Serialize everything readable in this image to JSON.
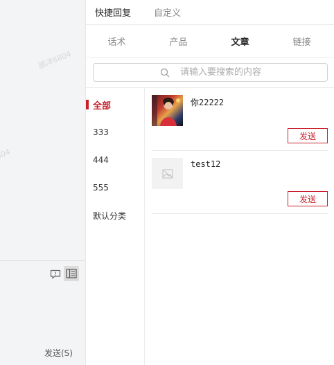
{
  "chat": {
    "watermark_1": "郦洋8804",
    "watermark_2": "804",
    "send_label": "发送(S)",
    "feedback_icon": "chat-feedback-icon",
    "panel_icon": "side-panel-icon"
  },
  "top_tabs": {
    "quick_reply": "快捷回复",
    "custom": "自定义"
  },
  "sub_tabs": [
    "话术",
    "产品",
    "文章",
    "链接"
  ],
  "active_sub_tab": "文章",
  "search": {
    "placeholder": "请输入要搜索的内容"
  },
  "categories": [
    "全部",
    "333",
    "444",
    "555",
    "默认分类"
  ],
  "active_category": "全部",
  "articles": [
    {
      "title": "你22222",
      "send_label": "发送"
    },
    {
      "title": "test12",
      "send_label": "发送"
    }
  ],
  "colors": {
    "accent": "#c81f2b",
    "left_bg": "#f3f4f5"
  }
}
